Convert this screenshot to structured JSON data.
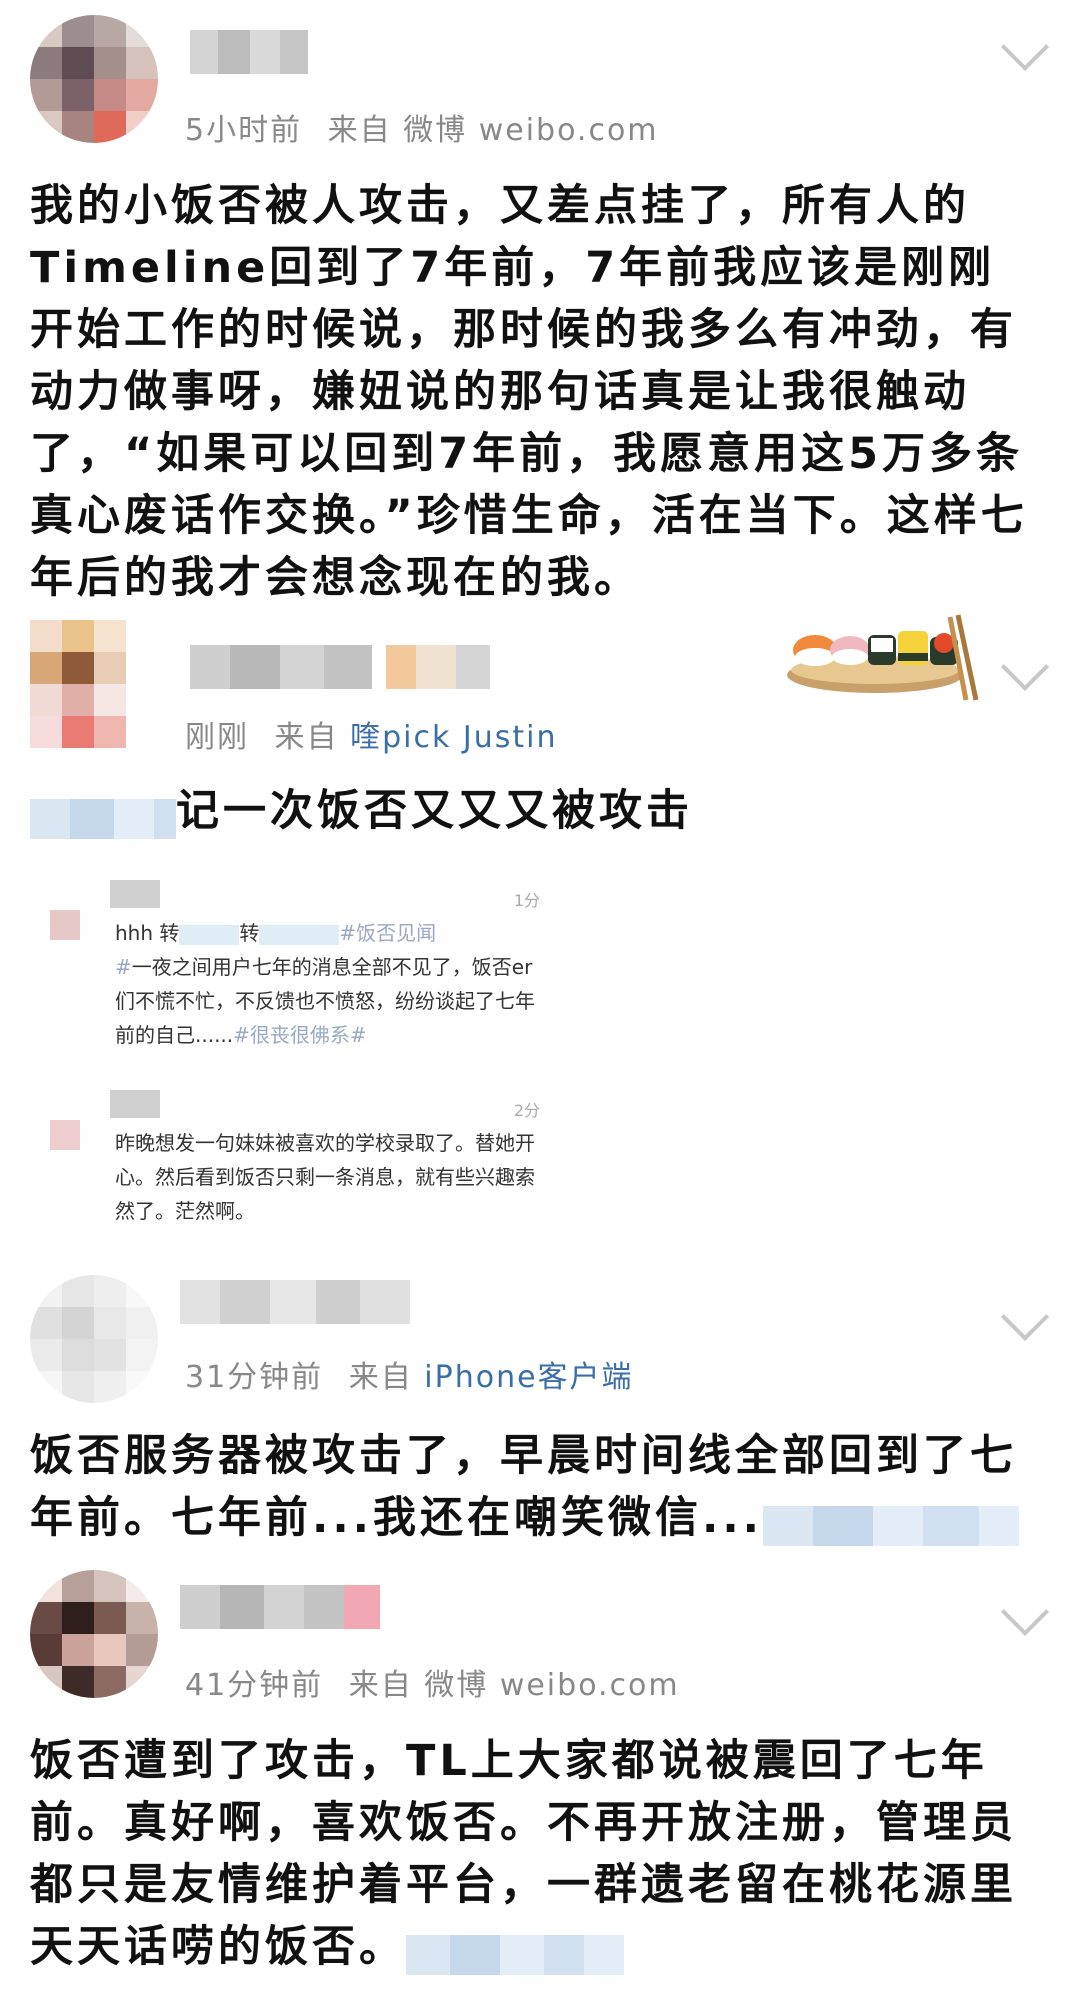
{
  "posts": [
    {
      "time": "5小时前",
      "from": "来自",
      "source": "微博 weibo.com",
      "text": "我的小饭否被人攻击，又差点挂了，所有人的Timeline回到了7年前，7年前我应该是刚刚开始工作的时候说，那时候的我多么有冲劲，有动力做事呀，嫌妞说的那句话真是让我很触动了，“如果可以回到7年前，我愿意用这5万多条真心废话作交换。”珍惜生命，活在当下。这样七年后的我才会想念现在的我。"
    },
    {
      "time": "刚刚",
      "from": "来自",
      "source": "喹pick Justin",
      "text": "记一次饭否又又又被攻击",
      "embed": [
        {
          "time": "1分",
          "line1": "hhh 转",
          "line1b": "转",
          "tag1": "#饭否见闻",
          "tag2": "#",
          "text": "一夜之间用户七年的消息全部不见了，饭否er们不慌不忙，不反馈也不愤怒，纷纷谈起了七年前的自己......",
          "tag3": "#很丧很佛系#"
        },
        {
          "time": "2分",
          "text": "昨晚想发一句妹妹被喜欢的学校录取了。替她开心。然后看到饭否只剩一条消息，就有些兴趣索然了。茫然啊。"
        }
      ]
    },
    {
      "time": "31分钟前",
      "from": "来自",
      "source": "iPhone客户端",
      "text": "饭否服务器被攻击了，早晨时间线全部回到了七年前。七年前...我还在嘲笑微信..."
    },
    {
      "time": "41分钟前",
      "from": "来自",
      "source": "微博 weibo.com",
      "text": "饭否遭到了攻击，TL上大家都说被震回了七年前。真好啊，喜欢饭否。不再开放注册，管理员都只是友情维护着平台，一群遗老留在桃花源里天天话唠的饭否。"
    }
  ],
  "colors": {
    "link": "#3a6ea8",
    "meta": "#888888",
    "tag": "#9aa8c6"
  }
}
